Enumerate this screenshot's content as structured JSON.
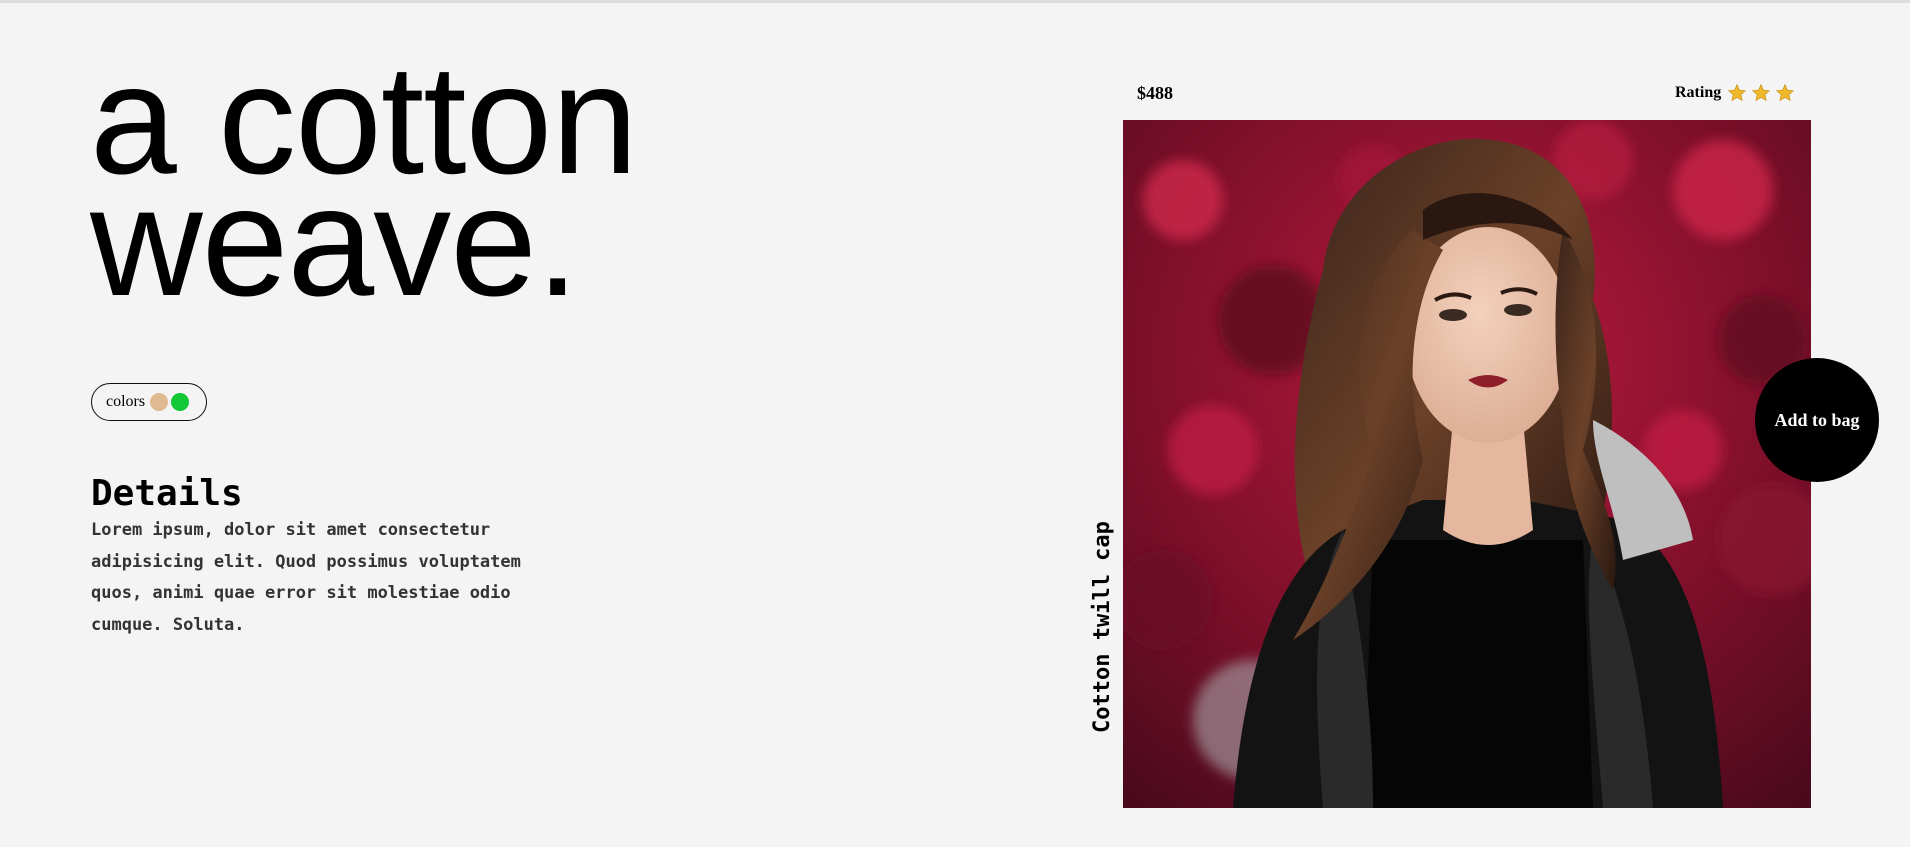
{
  "hero": {
    "title_line1": "a cotton",
    "title_line2": "weave."
  },
  "colors": {
    "label": "colors",
    "options": [
      {
        "name": "beige",
        "hex": "#dfb98f"
      },
      {
        "name": "green",
        "hex": "#13c737"
      }
    ]
  },
  "details": {
    "title": "Details",
    "body": "Lorem ipsum, dolor sit amet consectetur adipisicing elit. Quod possimus voluptatem quos, animi quae error sit molestiae odio cumque. Soluta."
  },
  "product": {
    "price": "$488",
    "rating_label": "Rating",
    "rating_stars": 3,
    "star_color": "#f0b92a",
    "name": "Cotton twill cap",
    "image_icon": "product-photo-woman-leather-jacket",
    "add_to_bag_label": "Add to bag"
  }
}
